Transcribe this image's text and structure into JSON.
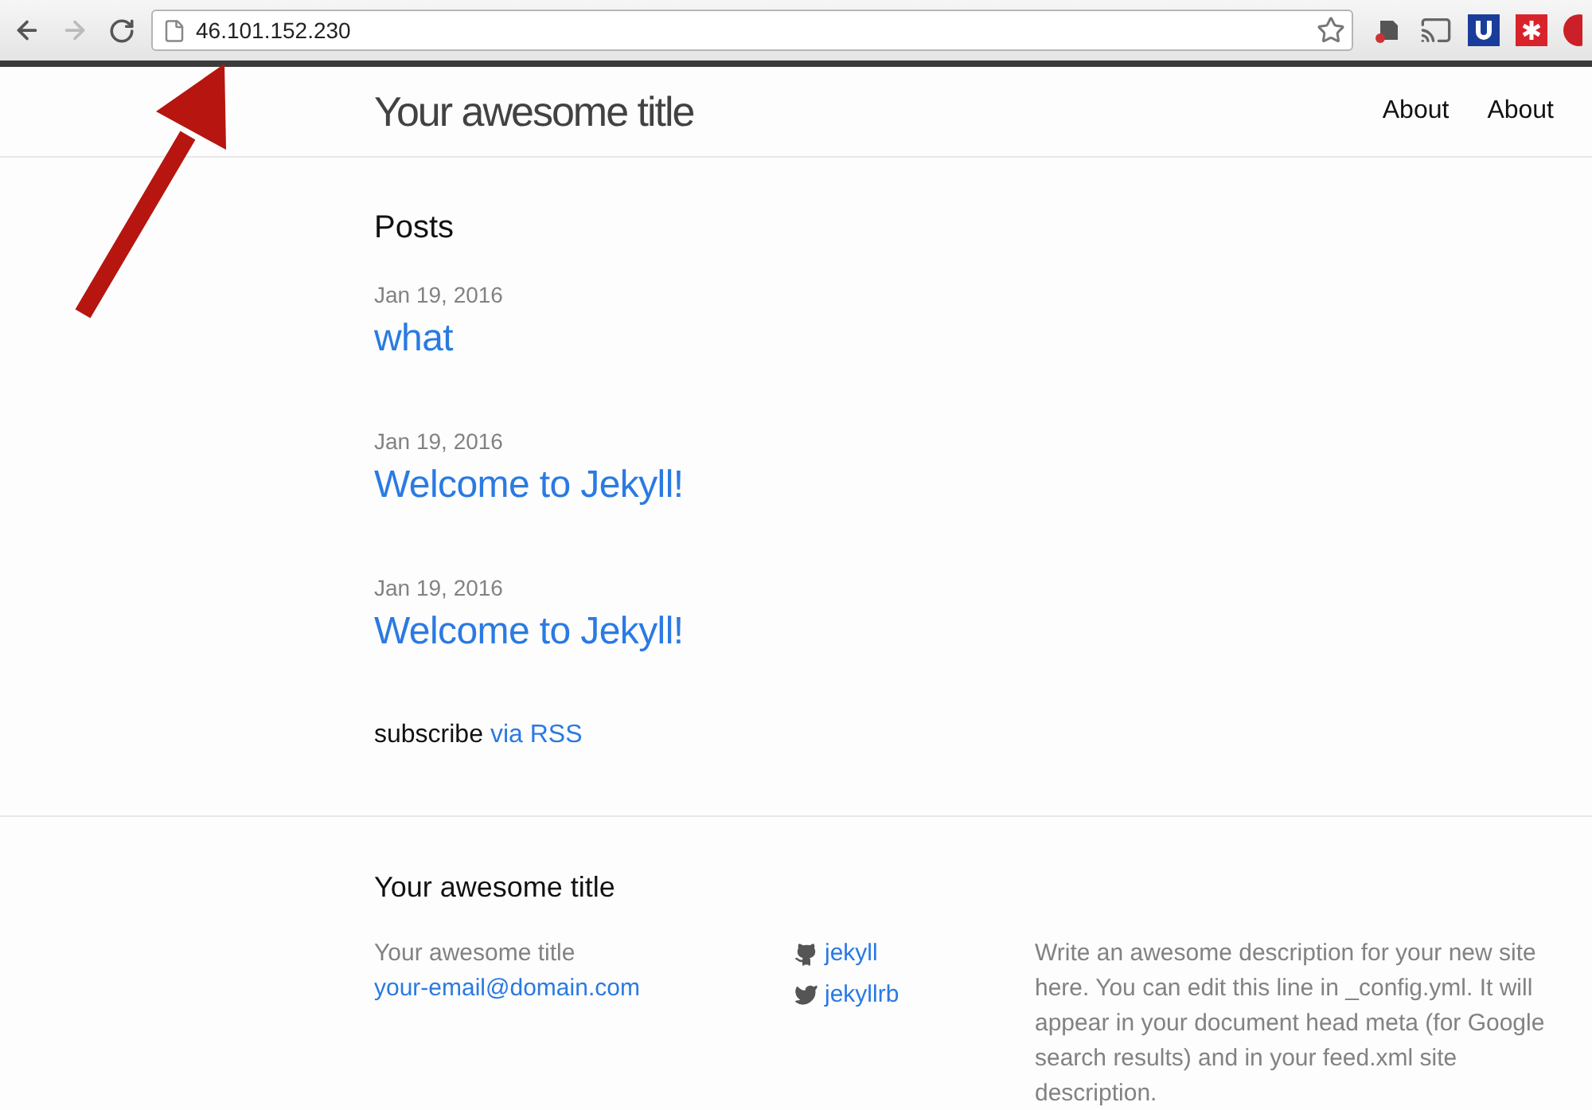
{
  "browser": {
    "url": "46.101.152.230",
    "back_enabled": true,
    "forward_enabled": false
  },
  "site": {
    "title": "Your awesome title",
    "nav": [
      {
        "label": "About"
      },
      {
        "label": "About"
      }
    ]
  },
  "posts_heading": "Posts",
  "posts": [
    {
      "date": "Jan 19, 2016",
      "title": "what"
    },
    {
      "date": "Jan 19, 2016",
      "title": "Welcome to Jekyll!"
    },
    {
      "date": "Jan 19, 2016",
      "title": "Welcome to Jekyll!"
    }
  ],
  "subscribe": {
    "text": "subscribe",
    "link": "via RSS"
  },
  "footer": {
    "heading": "Your awesome title",
    "name": "Your awesome title",
    "email": "your-email@domain.com",
    "social": [
      {
        "kind": "github",
        "label": "jekyll"
      },
      {
        "kind": "twitter",
        "label": "jekyllrb"
      }
    ],
    "description": "Write an awesome description for your new site here. You can edit this line in _config.yml. It will appear in your document head meta (for Google search results) and in your feed.xml site description."
  }
}
